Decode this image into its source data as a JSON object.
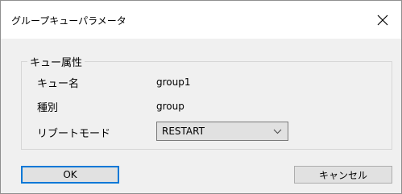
{
  "window": {
    "title": "グループキューパラメータ"
  },
  "group": {
    "legend": "キュー属性",
    "rows": [
      {
        "label": "キュー名",
        "value": "group1"
      },
      {
        "label": "種別",
        "value": "group"
      }
    ],
    "mode": {
      "label": "リブートモード",
      "selected": "RESTART"
    }
  },
  "buttons": {
    "ok": "OK",
    "cancel": "キャンセル"
  },
  "colors": {
    "accent": "#0078d7",
    "dialog_bg": "#f0f0f0"
  },
  "icons": {
    "close": "close-icon",
    "dropdown": "chevron-down-icon"
  }
}
